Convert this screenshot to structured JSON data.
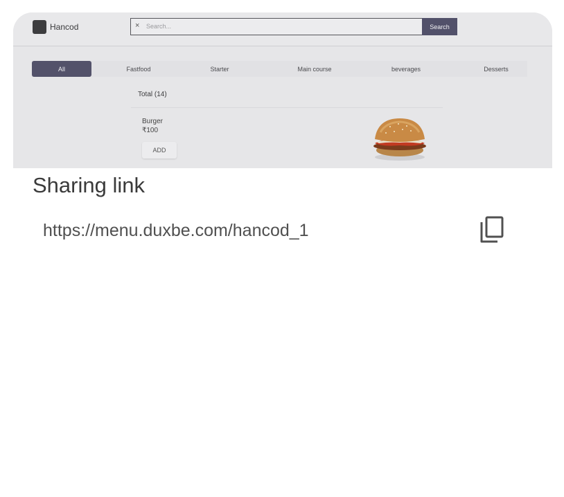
{
  "preview": {
    "brand": "Hancod",
    "search": {
      "clear_glyph": "×",
      "placeholder": "Search...",
      "button": "Search"
    },
    "categories": [
      "All",
      "Fastfood",
      "Starter",
      "Main course",
      "beverages",
      "Desserts"
    ],
    "active_category": "All",
    "total": "Total (14)",
    "item": {
      "name": "Burger",
      "price": "₹100",
      "add_label": "ADD",
      "image_icon": "burger-image"
    }
  },
  "share": {
    "title": "Sharing link",
    "url": "https://menu.duxbe.com/hancod_1",
    "copy_icon": "copy-icon"
  },
  "colors": {
    "accent": "#53526a",
    "preview_bg": "#e6e6e8",
    "text": "#3a3a3a"
  }
}
